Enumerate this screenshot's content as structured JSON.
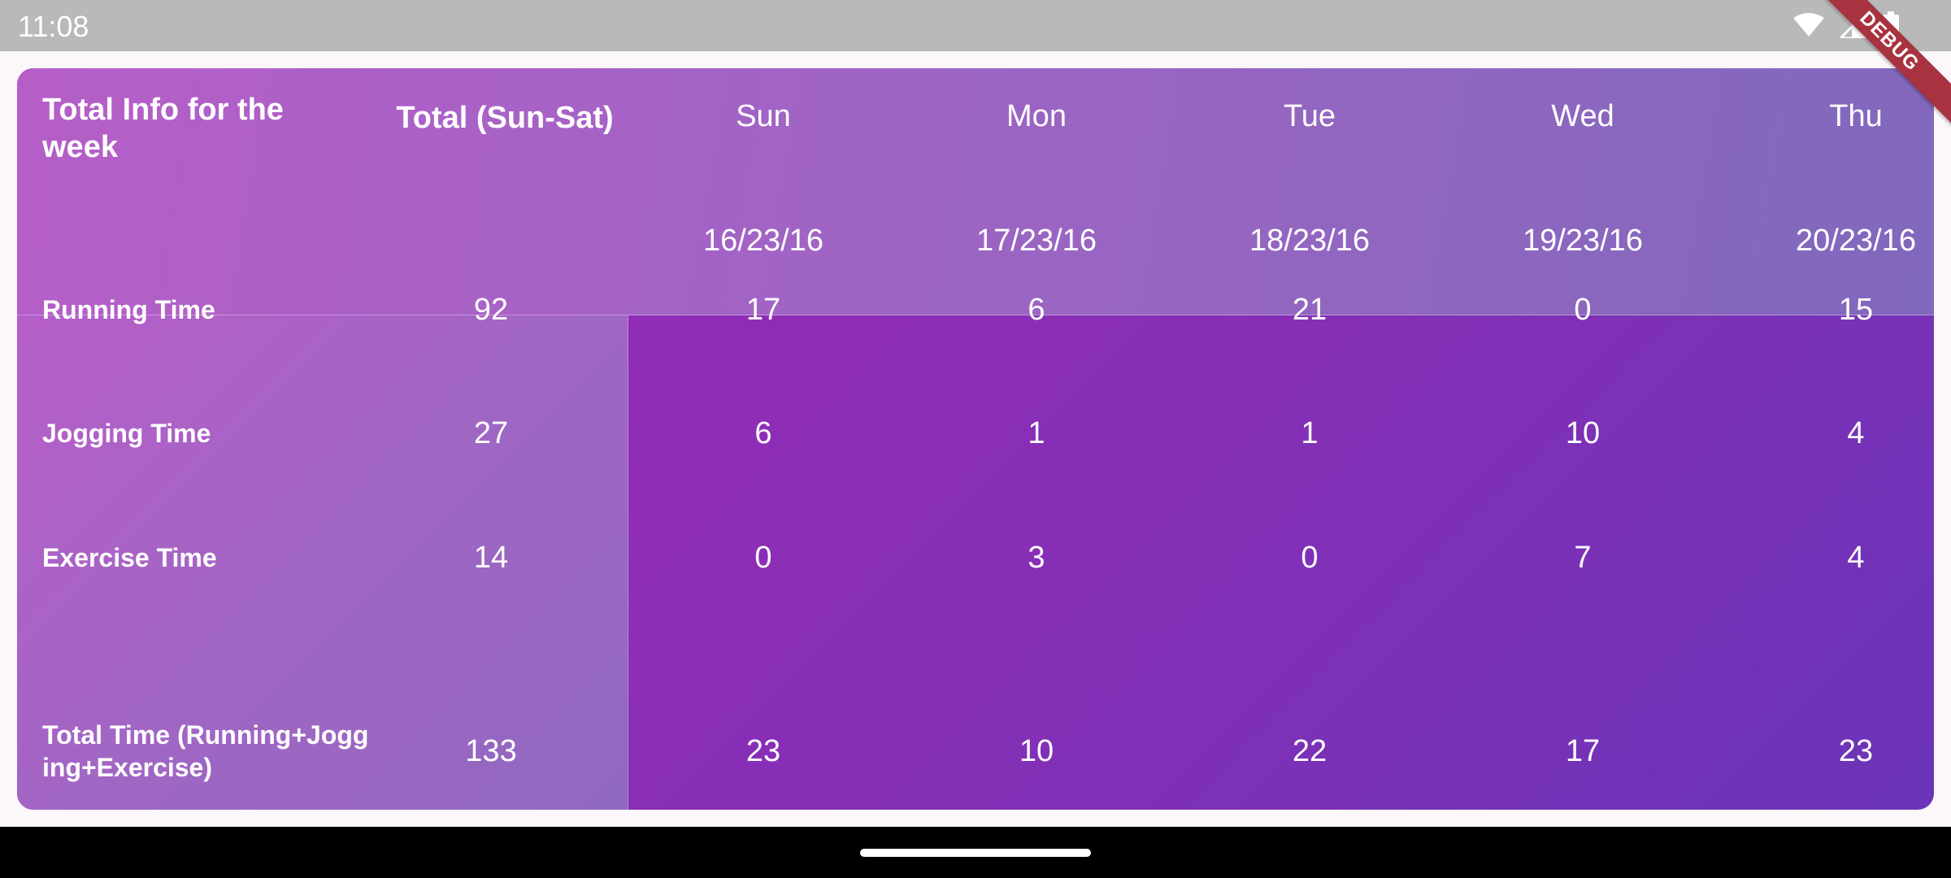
{
  "status": {
    "time": "11:08",
    "debug_label": "DEBUG"
  },
  "table": {
    "corner_title": "Total Info for the week",
    "total_header": "Total (Sun-Sat)",
    "days": [
      {
        "name": "Sun",
        "date": "16/23/16"
      },
      {
        "name": "Mon",
        "date": "17/23/16"
      },
      {
        "name": "Tue",
        "date": "18/23/16"
      },
      {
        "name": "Wed",
        "date": "19/23/16"
      },
      {
        "name": "Thu",
        "date": "20/23/16"
      }
    ],
    "rows": [
      {
        "label": "Running Time",
        "total": "92",
        "values": [
          "17",
          "6",
          "21",
          "0",
          "15"
        ]
      },
      {
        "label": "Jogging Time",
        "total": "27",
        "values": [
          "6",
          "1",
          "1",
          "10",
          "4"
        ]
      },
      {
        "label": "Exercise Time",
        "total": "14",
        "values": [
          "0",
          "3",
          "0",
          "7",
          "4"
        ]
      },
      {
        "label": "Total Time (Running+Jogging+Exercise)",
        "total": "133",
        "values": [
          "23",
          "10",
          "22",
          "17",
          "23"
        ]
      }
    ]
  },
  "colors": {
    "header_gradient_start": "#b65ec8",
    "body_gradient_start": "#9e27b4",
    "body_gradient_end": "#6b34b8"
  },
  "icons": {
    "wifi": "wifi-icon",
    "signal": "cell-signal-icon",
    "battery": "battery-icon"
  }
}
